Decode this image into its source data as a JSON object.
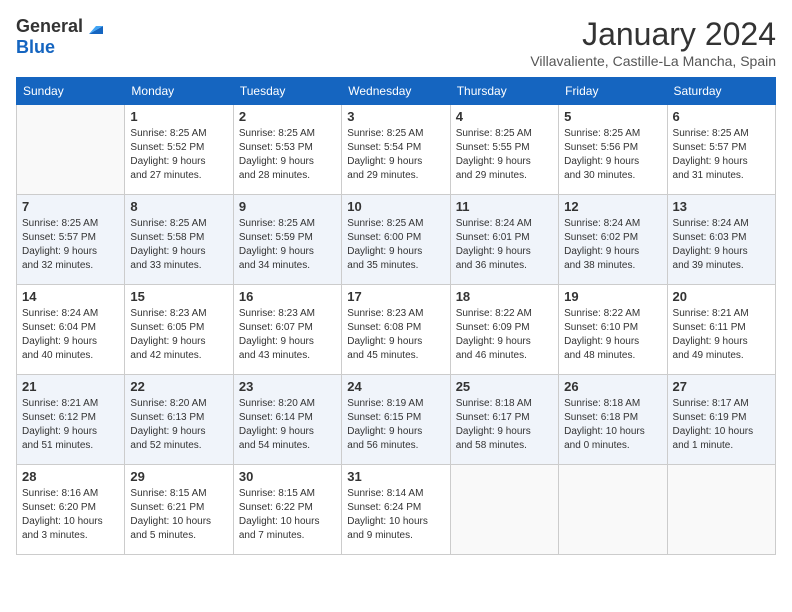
{
  "header": {
    "logo_general": "General",
    "logo_blue": "Blue",
    "month": "January 2024",
    "location": "Villavaliente, Castille-La Mancha, Spain"
  },
  "days_of_week": [
    "Sunday",
    "Monday",
    "Tuesday",
    "Wednesday",
    "Thursday",
    "Friday",
    "Saturday"
  ],
  "weeks": [
    [
      {
        "day": "",
        "info": ""
      },
      {
        "day": "1",
        "info": "Sunrise: 8:25 AM\nSunset: 5:52 PM\nDaylight: 9 hours\nand 27 minutes."
      },
      {
        "day": "2",
        "info": "Sunrise: 8:25 AM\nSunset: 5:53 PM\nDaylight: 9 hours\nand 28 minutes."
      },
      {
        "day": "3",
        "info": "Sunrise: 8:25 AM\nSunset: 5:54 PM\nDaylight: 9 hours\nand 29 minutes."
      },
      {
        "day": "4",
        "info": "Sunrise: 8:25 AM\nSunset: 5:55 PM\nDaylight: 9 hours\nand 29 minutes."
      },
      {
        "day": "5",
        "info": "Sunrise: 8:25 AM\nSunset: 5:56 PM\nDaylight: 9 hours\nand 30 minutes."
      },
      {
        "day": "6",
        "info": "Sunrise: 8:25 AM\nSunset: 5:57 PM\nDaylight: 9 hours\nand 31 minutes."
      }
    ],
    [
      {
        "day": "7",
        "info": "Sunrise: 8:25 AM\nSunset: 5:57 PM\nDaylight: 9 hours\nand 32 minutes."
      },
      {
        "day": "8",
        "info": "Sunrise: 8:25 AM\nSunset: 5:58 PM\nDaylight: 9 hours\nand 33 minutes."
      },
      {
        "day": "9",
        "info": "Sunrise: 8:25 AM\nSunset: 5:59 PM\nDaylight: 9 hours\nand 34 minutes."
      },
      {
        "day": "10",
        "info": "Sunrise: 8:25 AM\nSunset: 6:00 PM\nDaylight: 9 hours\nand 35 minutes."
      },
      {
        "day": "11",
        "info": "Sunrise: 8:24 AM\nSunset: 6:01 PM\nDaylight: 9 hours\nand 36 minutes."
      },
      {
        "day": "12",
        "info": "Sunrise: 8:24 AM\nSunset: 6:02 PM\nDaylight: 9 hours\nand 38 minutes."
      },
      {
        "day": "13",
        "info": "Sunrise: 8:24 AM\nSunset: 6:03 PM\nDaylight: 9 hours\nand 39 minutes."
      }
    ],
    [
      {
        "day": "14",
        "info": "Sunrise: 8:24 AM\nSunset: 6:04 PM\nDaylight: 9 hours\nand 40 minutes."
      },
      {
        "day": "15",
        "info": "Sunrise: 8:23 AM\nSunset: 6:05 PM\nDaylight: 9 hours\nand 42 minutes."
      },
      {
        "day": "16",
        "info": "Sunrise: 8:23 AM\nSunset: 6:07 PM\nDaylight: 9 hours\nand 43 minutes."
      },
      {
        "day": "17",
        "info": "Sunrise: 8:23 AM\nSunset: 6:08 PM\nDaylight: 9 hours\nand 45 minutes."
      },
      {
        "day": "18",
        "info": "Sunrise: 8:22 AM\nSunset: 6:09 PM\nDaylight: 9 hours\nand 46 minutes."
      },
      {
        "day": "19",
        "info": "Sunrise: 8:22 AM\nSunset: 6:10 PM\nDaylight: 9 hours\nand 48 minutes."
      },
      {
        "day": "20",
        "info": "Sunrise: 8:21 AM\nSunset: 6:11 PM\nDaylight: 9 hours\nand 49 minutes."
      }
    ],
    [
      {
        "day": "21",
        "info": "Sunrise: 8:21 AM\nSunset: 6:12 PM\nDaylight: 9 hours\nand 51 minutes."
      },
      {
        "day": "22",
        "info": "Sunrise: 8:20 AM\nSunset: 6:13 PM\nDaylight: 9 hours\nand 52 minutes."
      },
      {
        "day": "23",
        "info": "Sunrise: 8:20 AM\nSunset: 6:14 PM\nDaylight: 9 hours\nand 54 minutes."
      },
      {
        "day": "24",
        "info": "Sunrise: 8:19 AM\nSunset: 6:15 PM\nDaylight: 9 hours\nand 56 minutes."
      },
      {
        "day": "25",
        "info": "Sunrise: 8:18 AM\nSunset: 6:17 PM\nDaylight: 9 hours\nand 58 minutes."
      },
      {
        "day": "26",
        "info": "Sunrise: 8:18 AM\nSunset: 6:18 PM\nDaylight: 10 hours\nand 0 minutes."
      },
      {
        "day": "27",
        "info": "Sunrise: 8:17 AM\nSunset: 6:19 PM\nDaylight: 10 hours\nand 1 minute."
      }
    ],
    [
      {
        "day": "28",
        "info": "Sunrise: 8:16 AM\nSunset: 6:20 PM\nDaylight: 10 hours\nand 3 minutes."
      },
      {
        "day": "29",
        "info": "Sunrise: 8:15 AM\nSunset: 6:21 PM\nDaylight: 10 hours\nand 5 minutes."
      },
      {
        "day": "30",
        "info": "Sunrise: 8:15 AM\nSunset: 6:22 PM\nDaylight: 10 hours\nand 7 minutes."
      },
      {
        "day": "31",
        "info": "Sunrise: 8:14 AM\nSunset: 6:24 PM\nDaylight: 10 hours\nand 9 minutes."
      },
      {
        "day": "",
        "info": ""
      },
      {
        "day": "",
        "info": ""
      },
      {
        "day": "",
        "info": ""
      }
    ]
  ]
}
